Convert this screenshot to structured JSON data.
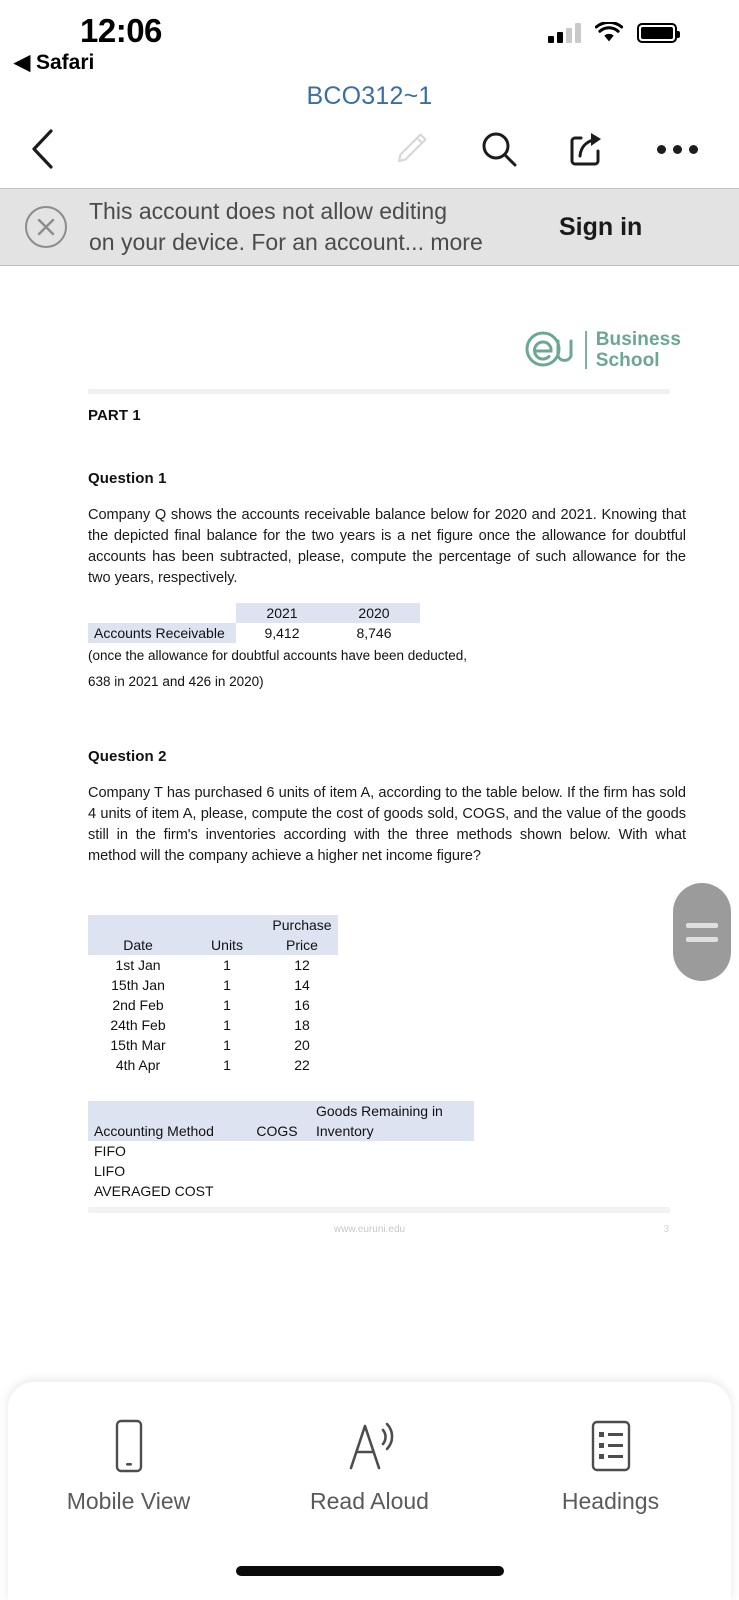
{
  "status_bar": {
    "time": "12:06",
    "back_app_label": "◀ Safari",
    "signal_icon": "cellular-signal-icon",
    "wifi_icon": "wifi-icon",
    "battery_icon": "battery-full-icon"
  },
  "app_bar": {
    "document_title": "BCO312~1",
    "title_color": "#3a6ea5",
    "buttons": [
      {
        "name": "back-button",
        "icon": "chevron-left-icon"
      },
      {
        "name": "edit-button",
        "icon": "pencil-icon",
        "disabled": true
      },
      {
        "name": "search-button",
        "icon": "search-icon"
      },
      {
        "name": "share-button",
        "icon": "share-icon"
      },
      {
        "name": "more-button",
        "icon": "ellipsis-icon"
      }
    ]
  },
  "banner": {
    "close_icon": "close-circle-icon",
    "line1": "This account does not allow editing",
    "line2": "on your device. For an account...",
    "more_label": "more",
    "sign_in_label": "Sign in",
    "background": "#e3e3e3"
  },
  "document": {
    "logo": {
      "mark": "eu-logo-icon",
      "line1": "Business",
      "line2": "School",
      "color": "#6aa890"
    },
    "part_title": "PART 1",
    "question1": {
      "heading": "Question 1",
      "paragraph": "Company Q shows the accounts receivable balance below for 2020 and 2021. Knowing that the depicted final balance for the two years is a net figure once the allowance for doubtful accounts has been subtracted, please, compute the percentage of such allowance for the two years, respectively.",
      "table": {
        "headers": [
          "",
          "2021",
          "2020"
        ],
        "rows": [
          [
            "Accounts Receivable",
            "9,412",
            "8,746"
          ]
        ]
      },
      "note_line1": "(once the allowance for doubtful accounts have been deducted,",
      "note_line2": "638 in 2021 and 426 in 2020)"
    },
    "question2": {
      "heading": "Question 2",
      "paragraph": "Company T has purchased 6 units of item A, according to the table below. If the firm has sold 4 units of item A, please, compute the cost of goods sold, COGS, and the value of the goods still in the firm's inventories according with the three methods shown below. With what method will the company achieve a higher net income figure?",
      "purchase_table": {
        "headers": [
          "Date",
          "Units",
          "Purchase Price"
        ],
        "header_line1": [
          "",
          "",
          "Purchase"
        ],
        "header_line2": [
          "Date",
          "Units",
          "Price"
        ],
        "rows": [
          [
            "1st Jan",
            "1",
            "12"
          ],
          [
            "15th Jan",
            "1",
            "14"
          ],
          [
            "2nd Feb",
            "1",
            "16"
          ],
          [
            "24th Feb",
            "1",
            "18"
          ],
          [
            "15th Mar",
            "1",
            "20"
          ],
          [
            "4th Apr",
            "1",
            "22"
          ]
        ]
      },
      "method_table": {
        "header_line1": [
          "",
          "",
          "Goods Remaining in"
        ],
        "header_line2": [
          "Accounting Method",
          "COGS",
          "Inventory"
        ],
        "rows": [
          [
            "FIFO",
            "",
            ""
          ],
          [
            "LIFO",
            "",
            ""
          ],
          [
            "AVERAGED COST",
            "",
            ""
          ]
        ]
      }
    },
    "footer": {
      "url": "www.euruni.edu",
      "page_number": "3"
    }
  },
  "scroll_handle": {
    "name": "scroll-drag-handle"
  },
  "bottom_bar": {
    "items": [
      {
        "label": "Mobile View",
        "icon": "phone-icon"
      },
      {
        "label": "Read Aloud",
        "icon": "read-aloud-icon"
      },
      {
        "label": "Headings",
        "icon": "headings-list-icon"
      }
    ]
  }
}
